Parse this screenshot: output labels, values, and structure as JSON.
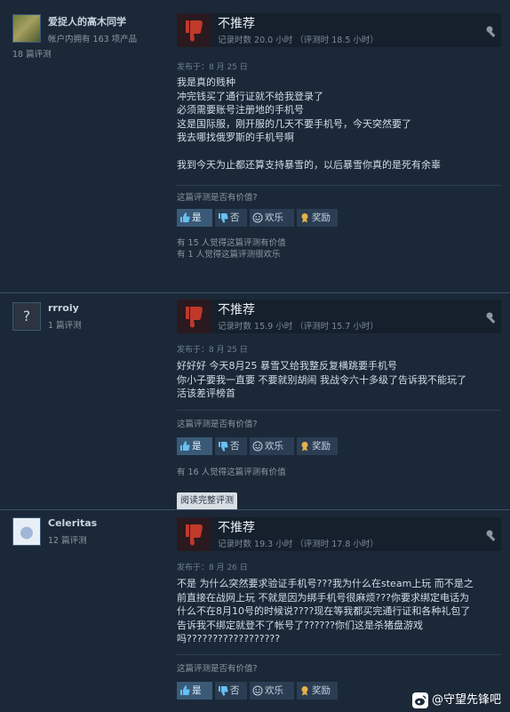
{
  "common": {
    "verdict": "不推荐",
    "helpful_question": "这篇评测是否有价值?",
    "btn_yes": "是",
    "btn_no": "否",
    "btn_funny": "欢乐",
    "btn_award": "奖励",
    "read_more": "阅读完整评测"
  },
  "reviews": [
    {
      "username": "爱捉人的高木同学",
      "products_owned": "帐户内拥有 163 项产品",
      "review_count": "18 篇评测",
      "hours": "记录时数 20.0 小时 （评测时 18.5 小时）",
      "date": "发布于：8 月 25 日",
      "lines": [
        "我是真的贱种",
        "冲完钱买了通行证就不给我登录了",
        "必须需要账号注册地的手机号",
        "这是国际服，刚开服的几天不要手机号，今天突然要了",
        "我去哪找俄罗斯的手机号啊",
        "",
        "我到今天为止都还算支持暴雪的，以后暴雪你真的是死有余辜"
      ],
      "votes": [
        "有 15 人觉得这篇评测有价值",
        "有 1 人觉得这篇评测很欢乐"
      ]
    },
    {
      "username": "rrroiy",
      "review_count": "1 篇评测",
      "hours": "记录时数 15.9 小时 （评测时 15.7 小时）",
      "date": "发布于：8 月 25 日",
      "lines": [
        "好好好 今天8月25 暴雪又给我整反复横跳要手机号",
        "你小子要我一直要 不要就别胡闹 我战令六十多级了告诉我不能玩了",
        "活该差评榜首"
      ],
      "votes": [
        "有 16 人觉得这篇评测有价值"
      ]
    },
    {
      "username": "Celeritas",
      "review_count": "12 篇评测",
      "hours": "记录时数 19.3 小时 （评测时 17.8 小时）",
      "date": "发布于：8 月 26 日",
      "lines": [
        "不是 为什么突然要求验证手机号???我为什么在steam上玩 而不是之",
        "前直接在战网上玩 不就是因为绑手机号很麻烦???你要求绑定电话为",
        "什么不在8月10号的时候说????现在等我都买完通行证和各种礼包了",
        "告诉我不绑定就登不了帐号了??????你们这是杀猪盘游戏",
        "吗??????????????????"
      ]
    }
  ],
  "watermark": "@守望先锋吧",
  "colors": {
    "bg": "#1b2838",
    "thumb_down": "#c0392b",
    "active_button": "#3a5a78"
  }
}
